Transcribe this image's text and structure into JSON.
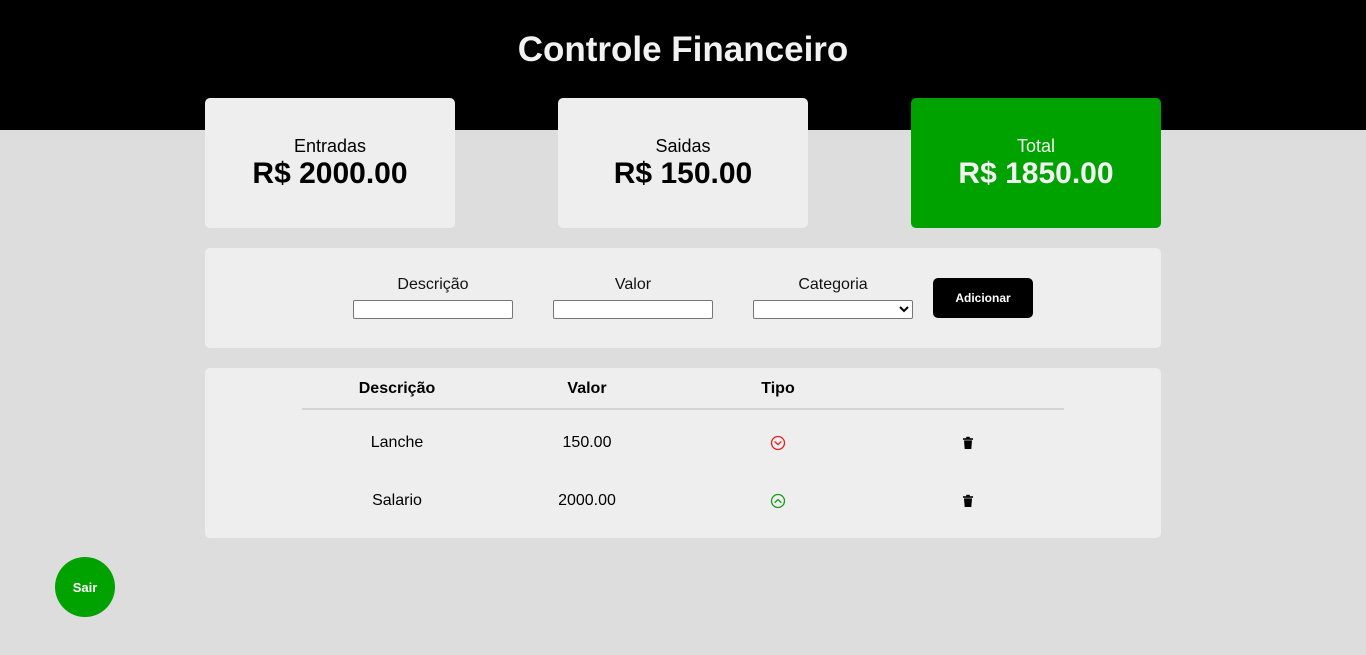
{
  "header": {
    "title": "Controle Financeiro"
  },
  "cards": {
    "entradas": {
      "label": "Entradas",
      "value": "R$ 2000.00"
    },
    "saidas": {
      "label": "Saidas",
      "value": "R$ 150.00"
    },
    "total": {
      "label": "Total",
      "value": "R$ 1850.00"
    }
  },
  "form": {
    "descricao_label": "Descrição",
    "descricao_value": "",
    "valor_label": "Valor",
    "valor_value": "",
    "categoria_label": "Categoria",
    "categoria_value": "",
    "add_label": "Adicionar"
  },
  "table": {
    "headers": [
      "Descrição",
      "Valor",
      "Tipo",
      ""
    ],
    "rows": [
      {
        "descricao": "Lanche",
        "valor": "150.00",
        "tipo_icon": "chevron-down-circle-icon"
      },
      {
        "descricao": "Salario",
        "valor": "2000.00",
        "tipo_icon": "chevron-up-circle-icon"
      }
    ]
  },
  "colors": {
    "header_bg": "#000000",
    "accent_green": "#00a200",
    "expense_red": "#e02020",
    "income_green": "#1a9a1a",
    "card_bg": "#eeeeee",
    "page_bg": "#dddddd"
  },
  "sair_label": "Sair"
}
